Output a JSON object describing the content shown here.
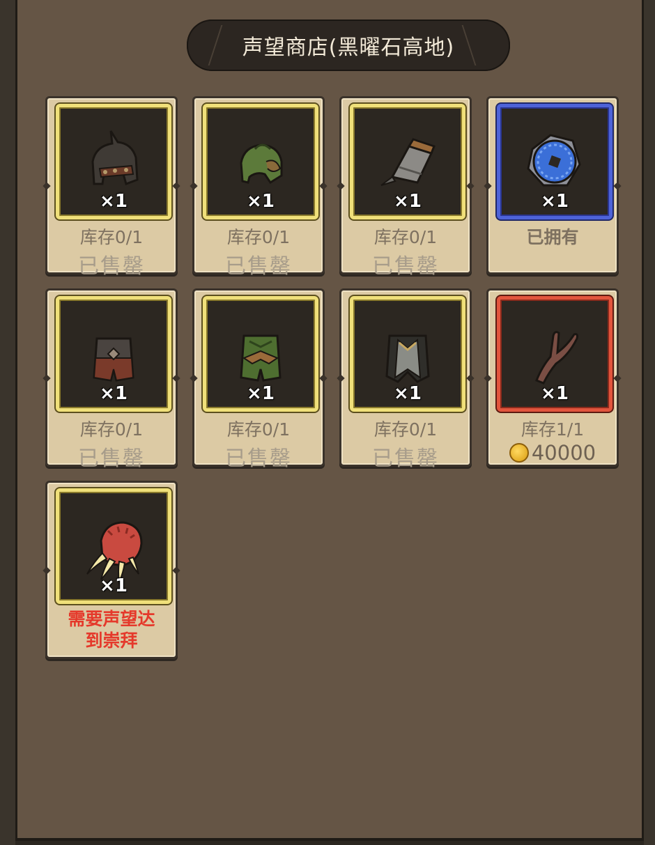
{
  "title": "声望商店(黑曜石高地)",
  "items": [
    {
      "icon": "horned-helmet-icon",
      "quantity": "×1",
      "stock": "库存0/1",
      "status": "已售罄",
      "rarity": "gold"
    },
    {
      "icon": "green-helmet-icon",
      "quantity": "×1",
      "stock": "库存0/1",
      "status": "已售罄",
      "rarity": "gold"
    },
    {
      "icon": "gauntlet-icon",
      "quantity": "×1",
      "stock": "库存0/1",
      "status": "已售罄",
      "rarity": "gold"
    },
    {
      "icon": "blue-ring-icon",
      "quantity": "×1",
      "status": "已拥有",
      "rarity": "blue"
    },
    {
      "icon": "dark-leg-armor-icon",
      "quantity": "×1",
      "stock": "库存0/1",
      "status": "已售罄",
      "rarity": "gold"
    },
    {
      "icon": "green-leg-armor-icon",
      "quantity": "×1",
      "stock": "库存0/1",
      "status": "已售罄",
      "rarity": "gold"
    },
    {
      "icon": "cloak-leg-armor-icon",
      "quantity": "×1",
      "stock": "库存0/1",
      "status": "已售罄",
      "rarity": "gold"
    },
    {
      "icon": "branch-icon",
      "quantity": "×1",
      "stock": "库存1/1",
      "price": "40000",
      "currency_icon": "gold-coin-icon",
      "rarity": "red"
    },
    {
      "icon": "claw-icon",
      "quantity": "×1",
      "requirement_line1": "需要声望达",
      "requirement_line2": "到崇拜",
      "rarity": "gold"
    }
  ],
  "colors": {
    "panel": "#655545",
    "card": "#dccaa4",
    "gold_frame": "#f0e07a",
    "blue_frame": "#4e63d8",
    "red_frame": "#e2553d",
    "requirement_text": "#e5392b"
  }
}
